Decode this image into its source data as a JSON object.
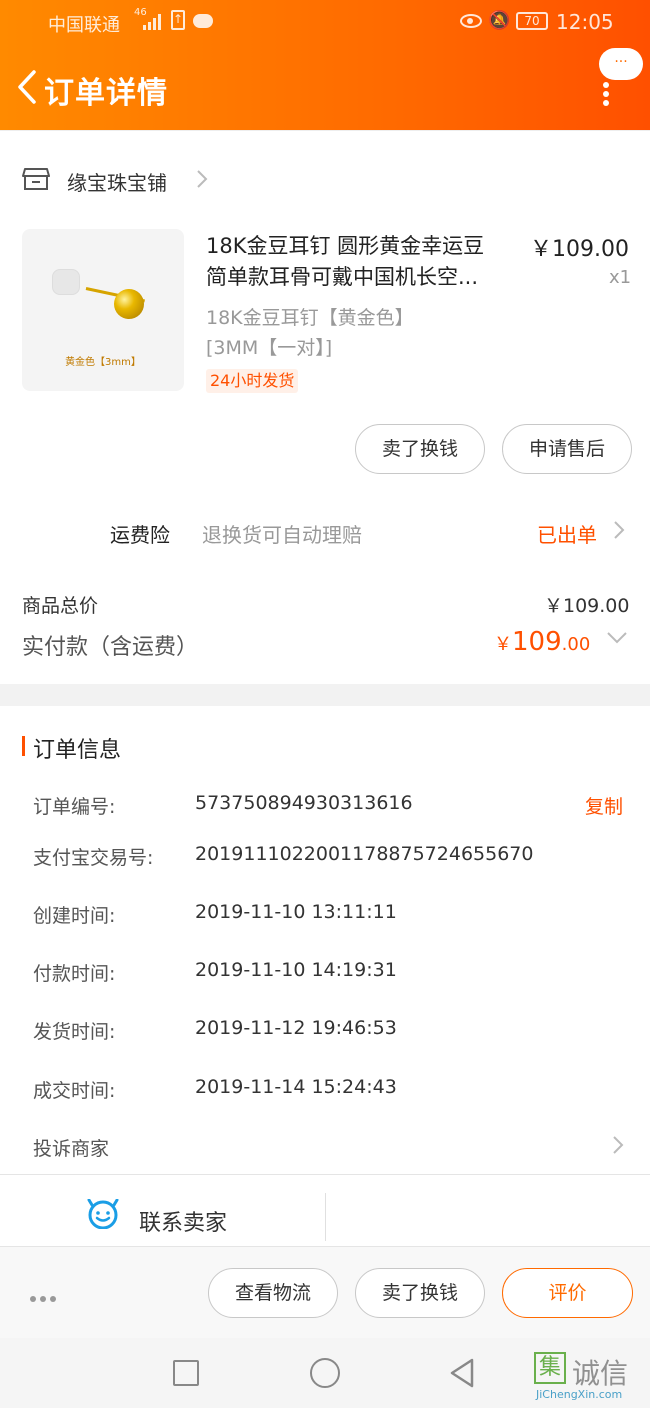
{
  "status_bar": {
    "carrier": "中国联通",
    "network": "46",
    "battery": "70",
    "time": "12:05"
  },
  "header": {
    "title": "订单详情",
    "more_label": "···"
  },
  "shop": {
    "name": "缘宝珠宝铺"
  },
  "product": {
    "title_line1": "18K金豆耳钉 圆形黄金幸运豆",
    "title_line2": "简单款耳骨可戴中国机长空...",
    "price": "￥109.00",
    "quantity": "x1",
    "sku_line1": "18K金豆耳钉【黄金色】",
    "sku_line2": "[3MM【一对】]",
    "badge": "24小时发货",
    "image_caption": "黄金色【3mm】"
  },
  "item_actions": {
    "sell_label": "卖了换钱",
    "aftersale_label": "申请售后"
  },
  "insurance": {
    "label": "运费险",
    "desc": "退换货可自动理赔",
    "status": "已出单"
  },
  "totals": {
    "goods_label": "商品总价",
    "goods_value": "￥109.00",
    "paid_label": "实付款（含运费）",
    "paid_yen": "￥",
    "paid_int": "109",
    "paid_dec": ".00"
  },
  "order_info": {
    "title": "订单信息",
    "copy_label": "复制",
    "rows": [
      {
        "label": "订单编号:",
        "value": "573750894930313616"
      },
      {
        "label": "支付宝交易号:",
        "value": "2019111022001178875724655670"
      },
      {
        "label": "创建时间:",
        "value": "2019-11-10 13:11:11"
      },
      {
        "label": "付款时间:",
        "value": "2019-11-10 14:19:31"
      },
      {
        "label": "发货时间:",
        "value": "2019-11-12 19:46:53"
      },
      {
        "label": "成交时间:",
        "value": "2019-11-14 15:24:43"
      }
    ],
    "complain_label": "投诉商家"
  },
  "contact": {
    "label": "联系卖家"
  },
  "bottom_actions": {
    "logistics_label": "查看物流",
    "sell_label": "卖了换钱",
    "review_label": "评价"
  },
  "watermark": {
    "logo_char": "集",
    "text": "诚信",
    "sub": "JiChengXin.com"
  },
  "colors": {
    "accent": "#ff5000",
    "header_start": "#ff8a00",
    "header_end": "#ff5000"
  }
}
